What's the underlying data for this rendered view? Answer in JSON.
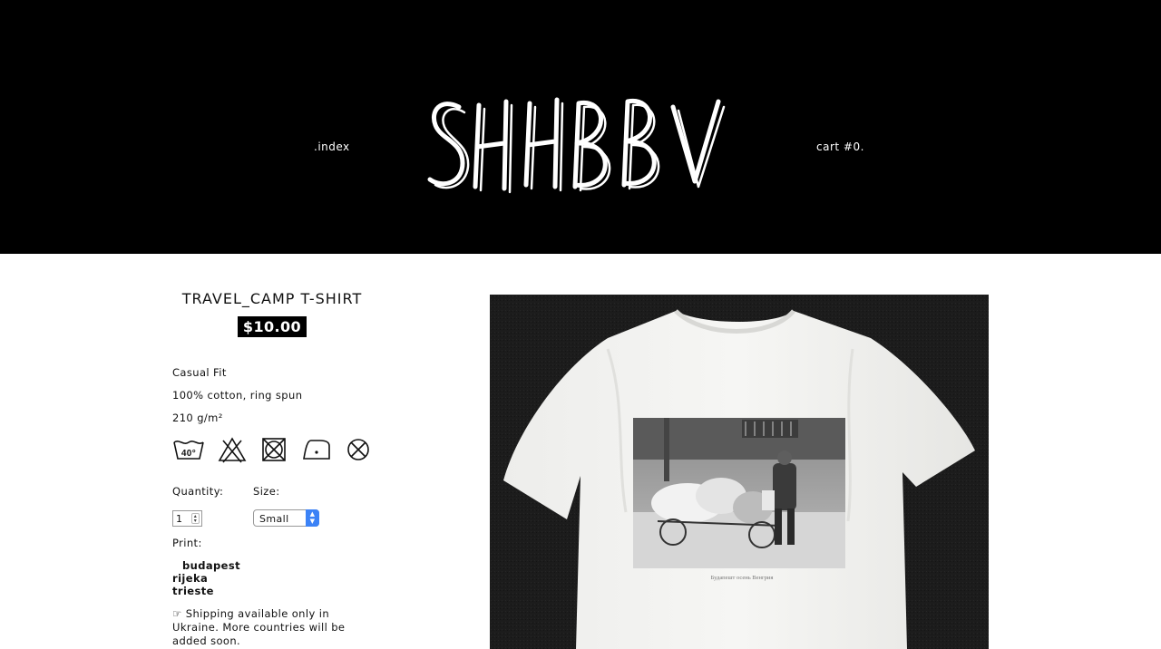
{
  "header": {
    "logo_text": "SHHBBV",
    "nav_index": ".index",
    "nav_cart": "cart #0."
  },
  "product": {
    "title": "TRAVEL_CAMP T-SHIRT",
    "price": "$10.00",
    "specs": [
      "Casual Fit",
      "100% cotton, ring spun",
      "210 g/m²"
    ],
    "care_icons": [
      "wash-40-icon",
      "no-bleach-icon",
      "no-tumble-dry-icon",
      "iron-low-icon",
      "no-dry-clean-icon"
    ],
    "care_wash_temp": "40°"
  },
  "form": {
    "quantity_label": "Quantity:",
    "quantity_value": "1",
    "size_label": "Size:",
    "size_value": "Small",
    "print_label": "Print:",
    "print_options": [
      "budapest",
      "rijeka",
      "trieste"
    ]
  },
  "shipping_note": "☞ Shipping available only in Ukraine. More countries will be added soon.",
  "image": {
    "caption_on_shirt": "Будапешт осень Венгрия"
  },
  "colors": {
    "header_bg": "#000000",
    "price_bg": "#000000",
    "select_accent": "#3b82f6"
  }
}
